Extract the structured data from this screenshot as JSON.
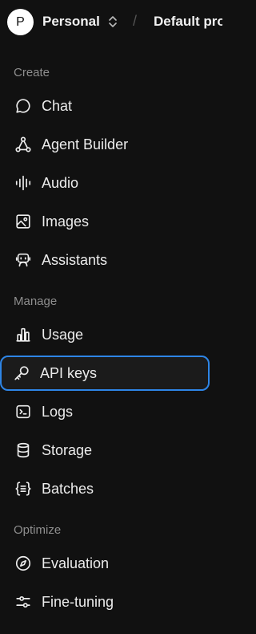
{
  "header": {
    "avatar_letter": "P",
    "org_name": "Personal",
    "separator": "/",
    "project_name": "Default pro"
  },
  "sections": {
    "create": "Create",
    "manage": "Manage",
    "optimize": "Optimize"
  },
  "nav": {
    "chat": "Chat",
    "agent_builder": "Agent Builder",
    "audio": "Audio",
    "images": "Images",
    "assistants": "Assistants",
    "usage": "Usage",
    "api_keys": "API keys",
    "logs": "Logs",
    "storage": "Storage",
    "batches": "Batches",
    "evaluation": "Evaluation",
    "fine_tuning": "Fine-tuning"
  },
  "active_item": "API keys",
  "colors": {
    "background": "#111111",
    "active_border": "#2e85e6",
    "section_label": "#8e8e8e",
    "text": "#ececec"
  }
}
